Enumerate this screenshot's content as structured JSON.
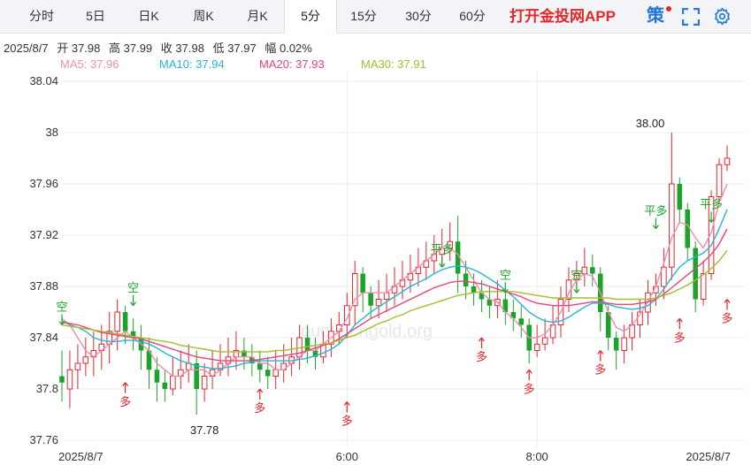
{
  "tabs": [
    {
      "label": "分时",
      "active": false
    },
    {
      "label": "5日",
      "active": false
    },
    {
      "label": "日K",
      "active": false
    },
    {
      "label": "周K",
      "active": false
    },
    {
      "label": "月K",
      "active": false
    },
    {
      "label": "5分",
      "active": true
    },
    {
      "label": "15分",
      "active": false
    },
    {
      "label": "30分",
      "active": false
    },
    {
      "label": "60分",
      "active": false
    }
  ],
  "promo_label": "打开金投网APP",
  "strategy_label": "策",
  "icons": {
    "fullscreen": "fullscreen-icon",
    "settings": "settings-icon"
  },
  "colors": {
    "up": "#e4262b",
    "down": "#1aa52a",
    "ma5": "#f08cb0",
    "ma10": "#27b4d6",
    "ma20": "#e5457a",
    "ma30": "#a5be2c",
    "promo": "#e4262b",
    "strategy": "#1f73d9"
  },
  "quote": {
    "date": "2025/8/7",
    "open": "开 37.98",
    "high": "高 37.99",
    "close": "收 37.98",
    "low": "低 37.97",
    "amplitude": "幅 0.02%"
  },
  "ma_legend": {
    "ma5": "MA5: 37.96",
    "ma10": "MA10: 37.94",
    "ma20": "MA20: 37.93",
    "ma30": "MA30: 37.91"
  },
  "watermark": "quote.cngold.org",
  "chart_data": {
    "type": "candlestick",
    "ylim": [
      37.76,
      38.04
    ],
    "y_ticks": [
      "38.04",
      "38",
      "37.96",
      "37.92",
      "37.88",
      "37.84",
      "37.8",
      "37.76"
    ],
    "y_tick_values": [
      38.04,
      38.0,
      37.96,
      37.92,
      37.88,
      37.84,
      37.8,
      37.76
    ],
    "x_ticks": [
      {
        "label": "2025/8/7",
        "index": 0
      },
      {
        "label": "6:00",
        "index": 36
      },
      {
        "label": "8:00",
        "index": 60
      },
      {
        "label": "2025/8/7",
        "index": 84
      }
    ],
    "high_marker": {
      "label": "38.00",
      "value": 38.0,
      "index": 77
    },
    "low_marker": {
      "label": "37.78",
      "value": 37.78,
      "index": 18
    },
    "candles": [
      [
        37.81,
        37.805,
        37.83,
        37.79
      ],
      [
        37.8,
        37.815,
        37.83,
        37.785
      ],
      [
        37.815,
        37.82,
        37.835,
        37.8
      ],
      [
        37.82,
        37.825,
        37.84,
        37.81
      ],
      [
        37.825,
        37.83,
        37.845,
        37.81
      ],
      [
        37.83,
        37.835,
        37.85,
        37.815
      ],
      [
        37.835,
        37.845,
        37.86,
        37.82
      ],
      [
        37.845,
        37.86,
        37.87,
        37.83
      ],
      [
        37.86,
        37.845,
        37.865,
        37.835
      ],
      [
        37.845,
        37.84,
        37.855,
        37.83
      ],
      [
        37.84,
        37.83,
        37.85,
        37.815
      ],
      [
        37.83,
        37.815,
        37.84,
        37.8
      ],
      [
        37.815,
        37.805,
        37.825,
        37.79
      ],
      [
        37.805,
        37.8,
        37.815,
        37.79
      ],
      [
        37.8,
        37.81,
        37.825,
        37.795
      ],
      [
        37.81,
        37.815,
        37.83,
        37.8
      ],
      [
        37.815,
        37.82,
        37.835,
        37.805
      ],
      [
        37.82,
        37.8,
        37.83,
        37.78
      ],
      [
        37.8,
        37.81,
        37.82,
        37.79
      ],
      [
        37.81,
        37.815,
        37.83,
        37.8
      ],
      [
        37.815,
        37.82,
        37.835,
        37.81
      ],
      [
        37.82,
        37.825,
        37.84,
        37.81
      ],
      [
        37.825,
        37.83,
        37.845,
        37.815
      ],
      [
        37.83,
        37.825,
        37.84,
        37.815
      ],
      [
        37.825,
        37.82,
        37.835,
        37.81
      ],
      [
        37.82,
        37.815,
        37.83,
        37.805
      ],
      [
        37.815,
        37.81,
        37.825,
        37.8
      ],
      [
        37.81,
        37.815,
        37.83,
        37.8
      ],
      [
        37.815,
        37.82,
        37.835,
        37.805
      ],
      [
        37.82,
        37.825,
        37.84,
        37.81
      ],
      [
        37.825,
        37.84,
        37.85,
        37.815
      ],
      [
        37.84,
        37.83,
        37.85,
        37.82
      ],
      [
        37.83,
        37.825,
        37.84,
        37.815
      ],
      [
        37.825,
        37.835,
        37.845,
        37.82
      ],
      [
        37.835,
        37.845,
        37.855,
        37.825
      ],
      [
        37.845,
        37.85,
        37.86,
        37.835
      ],
      [
        37.85,
        37.865,
        37.875,
        37.84
      ],
      [
        37.865,
        37.89,
        37.9,
        37.85
      ],
      [
        37.89,
        37.875,
        37.895,
        37.86
      ],
      [
        37.875,
        37.865,
        37.88,
        37.855
      ],
      [
        37.865,
        37.87,
        37.885,
        37.855
      ],
      [
        37.87,
        37.875,
        37.89,
        37.86
      ],
      [
        37.875,
        37.88,
        37.895,
        37.865
      ],
      [
        37.88,
        37.885,
        37.9,
        37.87
      ],
      [
        37.885,
        37.89,
        37.905,
        37.875
      ],
      [
        37.89,
        37.895,
        37.91,
        37.88
      ],
      [
        37.895,
        37.9,
        37.915,
        37.885
      ],
      [
        37.9,
        37.905,
        37.92,
        37.89
      ],
      [
        37.905,
        37.91,
        37.925,
        37.895
      ],
      [
        37.91,
        37.915,
        37.93,
        37.9
      ],
      [
        37.915,
        37.89,
        37.935,
        37.875
      ],
      [
        37.89,
        37.88,
        37.9,
        37.87
      ],
      [
        37.88,
        37.875,
        37.89,
        37.865
      ],
      [
        37.875,
        37.87,
        37.885,
        37.86
      ],
      [
        37.87,
        37.865,
        37.88,
        37.855
      ],
      [
        37.865,
        37.87,
        37.885,
        37.855
      ],
      [
        37.87,
        37.86,
        37.875,
        37.85
      ],
      [
        37.86,
        37.855,
        37.87,
        37.845
      ],
      [
        37.855,
        37.85,
        37.865,
        37.84
      ],
      [
        37.85,
        37.83,
        37.855,
        37.82
      ],
      [
        37.83,
        37.835,
        37.85,
        37.825
      ],
      [
        37.835,
        37.84,
        37.855,
        37.83
      ],
      [
        37.84,
        37.85,
        37.865,
        37.835
      ],
      [
        37.85,
        37.87,
        37.88,
        37.84
      ],
      [
        37.87,
        37.885,
        37.895,
        37.86
      ],
      [
        37.885,
        37.89,
        37.9,
        37.875
      ],
      [
        37.89,
        37.895,
        37.91,
        37.88
      ],
      [
        37.895,
        37.89,
        37.905,
        37.88
      ],
      [
        37.89,
        37.86,
        37.895,
        37.845
      ],
      [
        37.86,
        37.84,
        37.865,
        37.83
      ],
      [
        37.84,
        37.83,
        37.845,
        37.815
      ],
      [
        37.83,
        37.84,
        37.85,
        37.82
      ],
      [
        37.84,
        37.85,
        37.86,
        37.83
      ],
      [
        37.85,
        37.86,
        37.87,
        37.84
      ],
      [
        37.86,
        37.875,
        37.885,
        37.85
      ],
      [
        37.875,
        37.88,
        37.89,
        37.865
      ],
      [
        37.88,
        37.895,
        37.91,
        37.87
      ],
      [
        37.895,
        37.96,
        38.0,
        37.885
      ],
      [
        37.96,
        37.94,
        37.965,
        37.93
      ],
      [
        37.94,
        37.91,
        37.945,
        37.9
      ],
      [
        37.91,
        37.87,
        37.915,
        37.86
      ],
      [
        37.87,
        37.89,
        37.9,
        37.865
      ],
      [
        37.89,
        37.95,
        37.955,
        37.885
      ],
      [
        37.95,
        37.975,
        37.98,
        37.945
      ],
      [
        37.975,
        37.98,
        37.99,
        37.97
      ]
    ],
    "ma_values": {
      "ma5": [
        37.855,
        37.85,
        37.84,
        37.83,
        37.825,
        37.83,
        37.835,
        37.84,
        37.845,
        37.84,
        37.835,
        37.83,
        37.82,
        37.815,
        37.81,
        37.81,
        37.815,
        37.815,
        37.815,
        37.81,
        37.815,
        37.82,
        37.825,
        37.825,
        37.825,
        37.82,
        37.82,
        37.815,
        37.815,
        37.82,
        37.825,
        37.83,
        37.83,
        37.835,
        37.84,
        37.845,
        37.855,
        37.87,
        37.875,
        37.875,
        37.875,
        37.875,
        37.88,
        37.885,
        37.89,
        37.895,
        37.9,
        37.905,
        37.91,
        37.91,
        37.905,
        37.895,
        37.885,
        37.875,
        37.87,
        37.868,
        37.86,
        37.855,
        37.848,
        37.84,
        37.84,
        37.843,
        37.85,
        37.86,
        37.875,
        37.885,
        37.89,
        37.888,
        37.875,
        37.86,
        37.848,
        37.845,
        37.85,
        37.858,
        37.868,
        37.88,
        37.898,
        37.918,
        37.93,
        37.928,
        37.918,
        37.91,
        37.922,
        37.945,
        37.96
      ],
      "ma10": [
        37.853,
        37.85,
        37.848,
        37.845,
        37.84,
        37.838,
        37.837,
        37.837,
        37.838,
        37.838,
        37.837,
        37.835,
        37.832,
        37.828,
        37.825,
        37.822,
        37.82,
        37.818,
        37.817,
        37.816,
        37.816,
        37.817,
        37.818,
        37.82,
        37.821,
        37.822,
        37.822,
        37.822,
        37.822,
        37.822,
        37.823,
        37.824,
        37.826,
        37.828,
        37.831,
        37.835,
        37.842,
        37.85,
        37.855,
        37.86,
        37.864,
        37.868,
        37.872,
        37.876,
        37.88,
        37.883,
        37.886,
        37.89,
        37.893,
        37.895,
        37.896,
        37.895,
        37.893,
        37.89,
        37.886,
        37.882,
        37.877,
        37.872,
        37.866,
        37.86,
        37.856,
        37.853,
        37.852,
        37.853,
        37.856,
        37.86,
        37.864,
        37.867,
        37.867,
        37.866,
        37.864,
        37.863,
        37.862,
        37.863,
        37.865,
        37.87,
        37.878,
        37.887,
        37.895,
        37.9,
        37.903,
        37.906,
        37.912,
        37.925,
        37.94
      ],
      "ma20": [
        37.852,
        37.851,
        37.85,
        37.848,
        37.846,
        37.844,
        37.843,
        37.842,
        37.841,
        37.84,
        37.839,
        37.837,
        37.835,
        37.833,
        37.831,
        37.829,
        37.827,
        37.825,
        37.824,
        37.823,
        37.822,
        37.822,
        37.822,
        37.822,
        37.822,
        37.823,
        37.824,
        37.825,
        37.826,
        37.827,
        37.828,
        37.83,
        37.832,
        37.834,
        37.836,
        37.839,
        37.843,
        37.847,
        37.851,
        37.855,
        37.858,
        37.861,
        37.864,
        37.867,
        37.87,
        37.873,
        37.876,
        37.879,
        37.881,
        37.883,
        37.884,
        37.884,
        37.883,
        37.882,
        37.88,
        37.878,
        37.876,
        37.874,
        37.872,
        37.869,
        37.867,
        37.866,
        37.865,
        37.865,
        37.865,
        37.866,
        37.867,
        37.868,
        37.868,
        37.867,
        37.866,
        37.866,
        37.866,
        37.867,
        37.868,
        37.87,
        37.874,
        37.879,
        37.884,
        37.889,
        37.894,
        37.899,
        37.905,
        37.913,
        37.925
      ],
      "ma30": [
        37.85,
        37.849,
        37.848,
        37.847,
        37.846,
        37.845,
        37.844,
        37.843,
        37.842,
        37.841,
        37.84,
        37.839,
        37.838,
        37.837,
        37.836,
        37.834,
        37.833,
        37.832,
        37.831,
        37.83,
        37.829,
        37.829,
        37.829,
        37.829,
        37.829,
        37.829,
        37.829,
        37.83,
        37.83,
        37.831,
        37.832,
        37.833,
        37.834,
        37.835,
        37.836,
        37.838,
        37.84,
        37.842,
        37.845,
        37.848,
        37.851,
        37.853,
        37.856,
        37.858,
        37.861,
        37.863,
        37.865,
        37.867,
        37.869,
        37.871,
        37.873,
        37.874,
        37.875,
        37.876,
        37.876,
        37.876,
        37.876,
        37.876,
        37.875,
        37.874,
        37.873,
        37.872,
        37.871,
        37.871,
        37.871,
        37.871,
        37.871,
        37.871,
        37.871,
        37.871,
        37.87,
        37.87,
        37.87,
        37.87,
        37.87,
        37.871,
        37.873,
        37.875,
        37.878,
        37.881,
        37.885,
        37.889,
        37.894,
        37.9,
        37.908
      ]
    },
    "signals": [
      {
        "label": "空",
        "index": 0,
        "value": 37.85,
        "kind": "short"
      },
      {
        "label": "空",
        "index": 9,
        "value": 37.865,
        "kind": "short"
      },
      {
        "label": "多",
        "index": 8,
        "value": 37.805,
        "kind": "long"
      },
      {
        "label": "多",
        "index": 25,
        "value": 37.8,
        "kind": "long"
      },
      {
        "label": "多",
        "index": 36,
        "value": 37.79,
        "kind": "long"
      },
      {
        "label": "平多",
        "index": 48,
        "value": 37.895,
        "kind": "short"
      },
      {
        "label": "多",
        "index": 53,
        "value": 37.84,
        "kind": "long"
      },
      {
        "label": "空",
        "index": 56,
        "value": 37.875,
        "kind": "short"
      },
      {
        "label": "多",
        "index": 59,
        "value": 37.815,
        "kind": "long"
      },
      {
        "label": "空",
        "index": 65,
        "value": 37.875,
        "kind": "short"
      },
      {
        "label": "多",
        "index": 68,
        "value": 37.83,
        "kind": "long"
      },
      {
        "label": "平多",
        "index": 75,
        "value": 37.925,
        "kind": "short"
      },
      {
        "label": "多",
        "index": 78,
        "value": 37.855,
        "kind": "long"
      },
      {
        "label": "平多",
        "index": 82,
        "value": 37.93,
        "kind": "short"
      },
      {
        "label": "多",
        "index": 84,
        "value": 37.87,
        "kind": "long"
      }
    ]
  }
}
